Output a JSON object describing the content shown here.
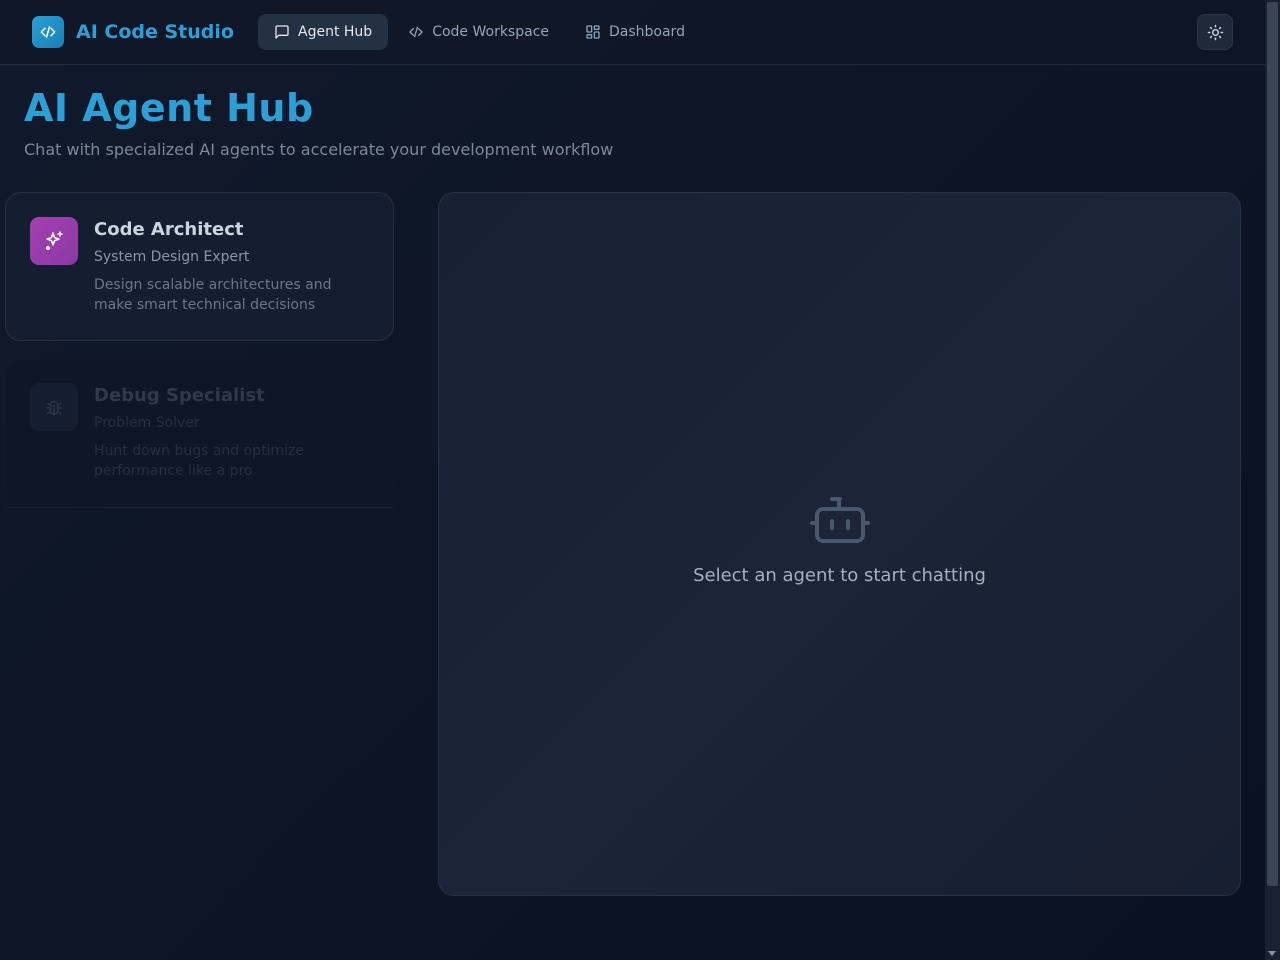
{
  "app": {
    "name": "AI Code Studio",
    "logo_icon": "code-icon"
  },
  "nav": {
    "items": [
      {
        "label": "Agent Hub",
        "icon": "message-square-icon",
        "active": true
      },
      {
        "label": "Code Workspace",
        "icon": "code-icon",
        "active": false
      },
      {
        "label": "Dashboard",
        "icon": "layout-dashboard-icon",
        "active": false
      }
    ],
    "theme_toggle_icon": "sun-icon"
  },
  "page": {
    "title": "AI Agent Hub",
    "subtitle": "Chat with specialized AI agents to accelerate your development workflow"
  },
  "agents": [
    {
      "name": "Code Architect",
      "role": "System Design Expert",
      "description": "Design scalable architectures and make smart technical decisions",
      "icon": "sparkles-icon",
      "accent": "#a63fb0"
    },
    {
      "name": "Debug Specialist",
      "role": "Problem Solver",
      "description": "Hunt down bugs and optimize performance like a pro",
      "icon": "bug-icon",
      "accent": "#1a2336"
    }
  ],
  "chat": {
    "empty_icon": "bot-icon",
    "empty_message": "Select an agent to start chatting"
  },
  "colors": {
    "brand": "#2b9fd6",
    "background": "#0b1120",
    "panel": "#182134"
  }
}
